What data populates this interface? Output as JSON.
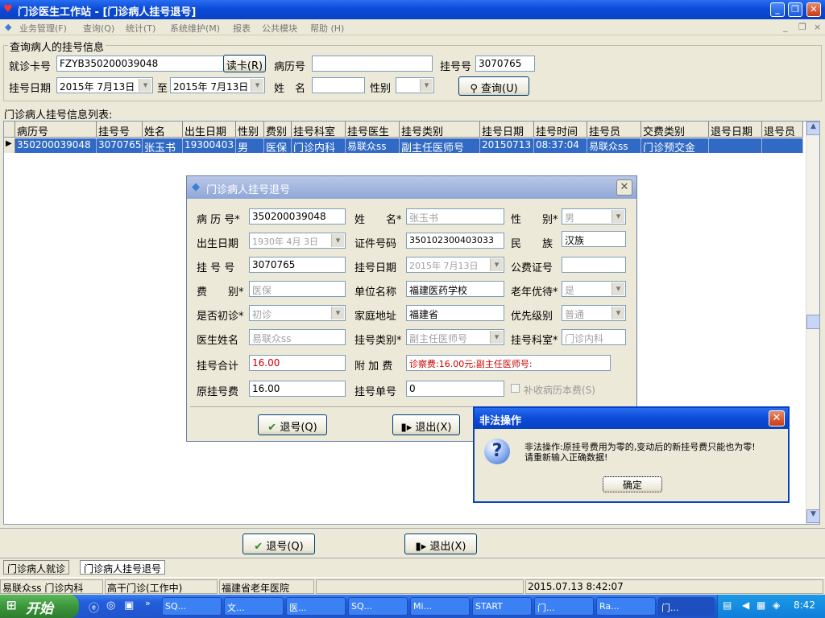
{
  "window": {
    "title": "门诊医生工作站 - [门诊病人挂号退号]",
    "min": "_",
    "restore": "❐",
    "close": "✕"
  },
  "menu": [
    "业务管理(F)",
    "查询(Q)",
    "统计(T)",
    "系统维护(M)",
    "报表",
    "公共模块",
    "帮助 (H)"
  ],
  "query": {
    "section_title": "查询病人的挂号信息",
    "card_label": "就诊卡号",
    "card_value": "FZYB350200039048",
    "read_card": "读卡(R)",
    "record_label": "病历号",
    "record_value": "",
    "reg_no_label": "挂号号",
    "reg_no_value": "3070765",
    "date_label": "挂号日期",
    "date_from": "2015年 7月13日",
    "to_label": "至",
    "date_to": "2015年 7月13日",
    "name_label": "姓　名",
    "name_value": "",
    "gender_label": "性别",
    "gender_value": "",
    "search_button": "查询(U)"
  },
  "list": {
    "title": "门诊病人挂号信息列表:",
    "headers": [
      "病历号",
      "挂号号",
      "姓名",
      "出生日期",
      "性别",
      "费别",
      "挂号科室",
      "挂号医生",
      "挂号类别",
      "挂号日期",
      "挂号时间",
      "挂号员",
      "交费类别",
      "退号日期",
      "退号员"
    ],
    "rows": [
      [
        "350200039048",
        "3070765",
        "张玉书",
        "19300403",
        "男",
        "医保",
        "门诊内科",
        "易联众ss",
        "副主任医师号",
        "20150713",
        "08:37:04",
        "易联众ss",
        "门诊预交金",
        "",
        ""
      ]
    ]
  },
  "dialog": {
    "title": "门诊病人挂号退号",
    "fields": {
      "record_label": "病 历 号*",
      "record_value": "350200039048",
      "name_label": "姓　　名*",
      "name_value": "张玉书",
      "gender_label": "性　　别*",
      "gender_value": "男",
      "birth_label": "出生日期",
      "birth_value": "1930年 4月 3日",
      "id_label": "证件号码",
      "id_value": "350102300403033",
      "ethnic_label": "民　　族",
      "ethnic_value": "汉族",
      "regno_label": "挂 号 号",
      "regno_value": "3070765",
      "regdate_label": "挂号日期",
      "regdate_value": "2015年 7月13日",
      "pubfee_label": "公费证号",
      "pubfee_value": "",
      "feetype_label": "费　　别*",
      "feetype_value": "医保",
      "unit_label": "单位名称",
      "unit_value": "福建医药学校",
      "elder_label": "老年优待*",
      "elder_value": "是",
      "firstvisit_label": "是否初诊*",
      "firstvisit_value": "初诊",
      "address_label": "家庭地址",
      "address_value": "福建省",
      "priority_label": "优先级别",
      "priority_value": "普通",
      "doctor_label": "医生姓名",
      "doctor_value": "易联众ss",
      "regtype_label": "挂号类别*",
      "regtype_value": "副主任医师号",
      "regdept_label": "挂号科室*",
      "regdept_value": "门诊内科",
      "total_label": "挂号合计",
      "total_value": "16.00",
      "extra_label": "附 加 费",
      "extra_value": "诊察费:16.00元;副主任医师号:",
      "origfee_label": "原挂号费",
      "origfee_value": "16.00",
      "regslip_label": "挂号单号",
      "regslip_value": "0",
      "supplement_label": "补收病历本费(S)"
    },
    "return_button": "退号(Q)",
    "exit_button": "退出(X)"
  },
  "error": {
    "title": "非法操作",
    "message_line1": "非法操作:原挂号费用为零的,变动后的新挂号费只能也为零!",
    "message_line2": "请重新输入正确数据!",
    "ok_button": "确定"
  },
  "bottom": {
    "return_button": "退号(Q)",
    "exit_button": "退出(X)"
  },
  "tabs": [
    "门诊病人就诊",
    "门诊病人挂号退号"
  ],
  "status": [
    "易联众ss",
    "门诊内科",
    "高干门诊(工作中)",
    "福建省老年医院",
    "2015.07.13 8:42:07"
  ],
  "taskbar": {
    "start": "开始",
    "items": [
      "SQ...",
      "文...",
      "医...",
      "SQ...",
      "Mi...",
      "START",
      "门...",
      "Ra...",
      "门..."
    ],
    "clock": "8:42"
  },
  "colors": {
    "title_blue": "#0a4bd8",
    "selection": "#316ac5",
    "error_red": "#cc0000"
  }
}
